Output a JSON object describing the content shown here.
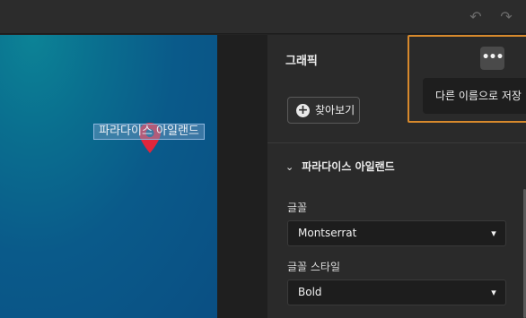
{
  "topbar": {
    "undo_icon": "undo-icon",
    "redo_icon": "redo-icon"
  },
  "canvas": {
    "selected_text": "파라다이스 아일랜드",
    "pin_icon": "map-pin-icon"
  },
  "panel": {
    "title": "그래픽",
    "more_button_glyph": "•••",
    "tooltip": "다른 이름으로 저장",
    "browse_label": "찾아보기",
    "section_title": "파라다이스 아일랜드",
    "font_label": "글꼴",
    "font_value": "Montserrat",
    "style_label": "글꼴 스타일",
    "style_value": "Bold"
  },
  "colors": {
    "highlight": "#d7892c",
    "pin": "#e0263b",
    "panel": "#2a2a2a"
  }
}
